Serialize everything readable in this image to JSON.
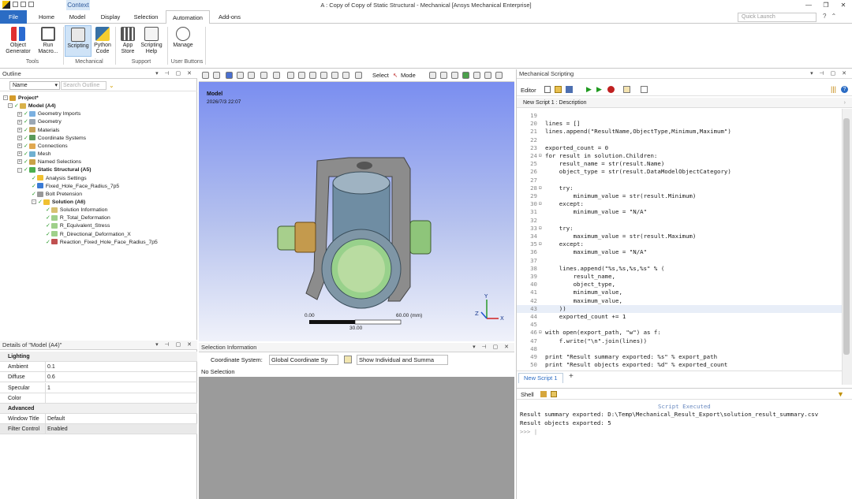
{
  "titlebar": {
    "context_tab": "Context",
    "window_title": "A : Copy of Copy of Static Structural - Mechanical [Ansys Mechanical Enterprise]",
    "controls": [
      "—",
      "❐",
      "✕"
    ]
  },
  "ribbon_tabs": [
    "File",
    "Home",
    "Model",
    "Display",
    "Selection",
    "Automation",
    "Add-ons"
  ],
  "quick_launch_placeholder": "Quick Launch",
  "ribbon": {
    "buttons": [
      {
        "label": "Object Generator"
      },
      {
        "label": "Run Macro..."
      },
      {
        "label": "Scripting"
      },
      {
        "label": "Python Code"
      },
      {
        "label": "App Store"
      },
      {
        "label": "Scripting Help"
      },
      {
        "label": "Manage"
      }
    ],
    "groups": [
      "Tools",
      "Mechanical",
      "Support",
      "User Buttons"
    ]
  },
  "outline": {
    "title": "Outline",
    "name_select": "Name",
    "search_placeholder": "Search Outline",
    "tree": [
      {
        "label": "Project*",
        "bold": true
      },
      {
        "label": "Model (A4)",
        "bold": true
      },
      {
        "label": "Geometry Imports"
      },
      {
        "label": "Geometry"
      },
      {
        "label": "Materials"
      },
      {
        "label": "Coordinate Systems"
      },
      {
        "label": "Connections"
      },
      {
        "label": "Mesh"
      },
      {
        "label": "Named Selections"
      },
      {
        "label": "Static Structural (A5)",
        "bold": true
      },
      {
        "label": "Analysis Settings"
      },
      {
        "label": "Fixed_Hole_Face_Radius_7p5"
      },
      {
        "label": "Bolt Pretension"
      },
      {
        "label": "Solution (A6)",
        "bold": true
      },
      {
        "label": "Solution Information"
      },
      {
        "label": "R_Total_Deformation"
      },
      {
        "label": "R_Equivalent_Stress"
      },
      {
        "label": "R_Directional_Deformation_X"
      },
      {
        "label": "Reaction_Fixed_Hole_Face_Radius_7p5"
      }
    ]
  },
  "details": {
    "title": "Details of \"Model (A4)\"",
    "rows": [
      {
        "cat": "Lighting"
      },
      {
        "k": "Ambient",
        "v": "0.1"
      },
      {
        "k": "Diffuse",
        "v": "0.6"
      },
      {
        "k": "Specular",
        "v": "1"
      },
      {
        "k": "Color",
        "v": ""
      },
      {
        "cat": "Advanced"
      },
      {
        "k": "Window Title",
        "v": "Default"
      },
      {
        "k": "Filter Control",
        "v": "Enabled"
      }
    ]
  },
  "graphics": {
    "select_label": "Select",
    "mode_label": "Mode",
    "model_label": "Model",
    "date": "2026/7/3 22:07",
    "scale_left": "0.00",
    "scale_right": "60.00 (mm)",
    "scale_mid": "30.00"
  },
  "selection_info": {
    "title": "Selection Information",
    "coord_label": "Coordinate System:",
    "coord_value": "Global Coordinate Sy",
    "show_value": "Show Individual and Summa",
    "status": "No Selection"
  },
  "scripting": {
    "title": "Mechanical Scripting",
    "editor_label": "Editor",
    "description": "New Script 1 : Description",
    "tab_label": "New Script 1",
    "add_tab": "+",
    "shell_label": "Shell",
    "code_lines": [
      {
        "n": "19",
        "fold": "",
        "t": ""
      },
      {
        "n": "20",
        "fold": "",
        "t": "lines = []"
      },
      {
        "n": "21",
        "fold": "",
        "t": "lines.append(\"ResultName,ObjectType,Minimum,Maximum\")"
      },
      {
        "n": "22",
        "fold": "",
        "t": ""
      },
      {
        "n": "23",
        "fold": "",
        "t": "exported_count = 0"
      },
      {
        "n": "24",
        "fold": "⊟",
        "t": "for result in solution.Children:"
      },
      {
        "n": "25",
        "fold": "",
        "t": "    result_name = str(result.Name)"
      },
      {
        "n": "26",
        "fold": "",
        "t": "    object_type = str(result.DataModelObjectCategory)"
      },
      {
        "n": "27",
        "fold": "",
        "t": ""
      },
      {
        "n": "28",
        "fold": "⊟",
        "t": "    try:"
      },
      {
        "n": "29",
        "fold": "",
        "t": "        minimum_value = str(result.Minimum)"
      },
      {
        "n": "30",
        "fold": "⊟",
        "t": "    except:"
      },
      {
        "n": "31",
        "fold": "",
        "t": "        minimum_value = \"N/A\""
      },
      {
        "n": "32",
        "fold": "",
        "t": ""
      },
      {
        "n": "33",
        "fold": "⊟",
        "t": "    try:"
      },
      {
        "n": "34",
        "fold": "",
        "t": "        maximum_value = str(result.Maximum)"
      },
      {
        "n": "35",
        "fold": "⊟",
        "t": "    except:"
      },
      {
        "n": "36",
        "fold": "",
        "t": "        maximum_value = \"N/A\""
      },
      {
        "n": "37",
        "fold": "",
        "t": ""
      },
      {
        "n": "38",
        "fold": "",
        "t": "    lines.append(\"%s,%s,%s,%s\" % ("
      },
      {
        "n": "39",
        "fold": "",
        "t": "        result_name,"
      },
      {
        "n": "40",
        "fold": "",
        "t": "        object_type,"
      },
      {
        "n": "41",
        "fold": "",
        "t": "        minimum_value,"
      },
      {
        "n": "42",
        "fold": "",
        "t": "        maximum_value,"
      },
      {
        "n": "43",
        "fold": "",
        "t": "    ))"
      },
      {
        "n": "44",
        "fold": "",
        "t": "    exported_count += 1"
      },
      {
        "n": "45",
        "fold": "",
        "t": ""
      },
      {
        "n": "46",
        "fold": "⊟",
        "t": "with open(export_path, \"w\") as f:"
      },
      {
        "n": "47",
        "fold": "",
        "t": "    f.write(\"\\n\".join(lines))"
      },
      {
        "n": "48",
        "fold": "",
        "t": ""
      },
      {
        "n": "49",
        "fold": "",
        "t": "print \"Result summary exported: %s\" % export_path"
      },
      {
        "n": "50",
        "fold": "",
        "t": "print \"Result objects exported: %d\" % exported_count"
      }
    ],
    "shell_lines": [
      "Script Executed",
      "Result summary exported: D:\\Temp\\Mechanical_Result_Export\\solution_result_summary.csv",
      "Result objects exported: 5",
      ">>> |"
    ]
  },
  "colors": {
    "file_tab": "#2b6cc4",
    "accent": "#2b579a",
    "viewport_top": "#7a8ef0",
    "check_green": "#2a9a2a"
  }
}
